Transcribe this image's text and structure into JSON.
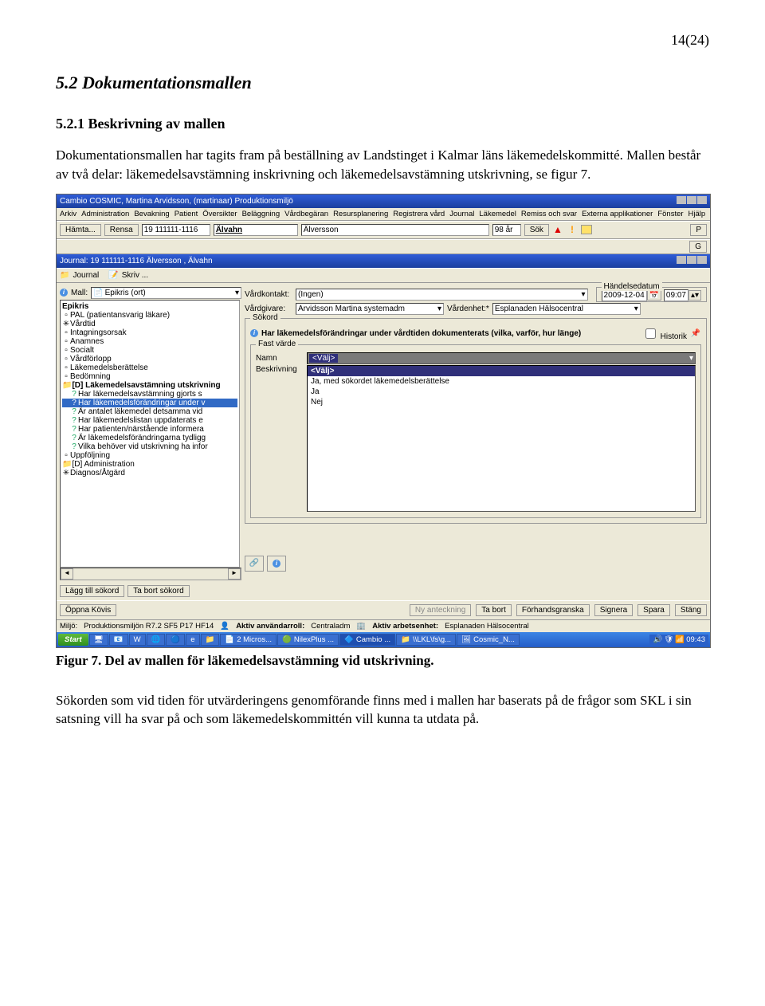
{
  "page_number": "14(24)",
  "h2": "5.2   Dokumentationsmallen",
  "h3": "5.2.1  Beskrivning av mallen",
  "para1": "Dokumentationsmallen har tagits fram på beställning av Landstinget i Kalmar läns läkemedelskommitté. Mallen består av två delar: läkemedelsavstämning inskrivning och läkemedelsavstämning utskrivning, se figur 7.",
  "caption": "Figur 7. Del av mallen för läkemedelsavstämning vid utskrivning.",
  "para2": "Sökorden som vid tiden för utvärderingens genomförande finns med i mallen har baserats på de frågor som SKL i sin satsning vill ha svar på och som läkemedelskommittén vill kunna ta utdata på.",
  "app": {
    "title": "Cambio COSMIC, Martina Arvidsson, (martinaar) Produktionsmiljö",
    "menu": [
      "Arkiv",
      "Administration",
      "Bevakning",
      "Patient",
      "Översikter",
      "Beläggning",
      "Vårdbegäran",
      "Resursplanering",
      "Registrera vård",
      "Journal",
      "Läkemedel",
      "Remiss och svar",
      "Externa applikationer",
      "Fönster",
      "Hjälp"
    ],
    "toolbar": {
      "hamta": "Hämta...",
      "rensa": "Rensa",
      "pnr": "19 111111-1116",
      "fname": "Älvahn",
      "lname": "Älversson",
      "age": "98 år",
      "sok": "Sök",
      "p": "P",
      "g": "G"
    },
    "journal_title": "Journal: 19 111111-1116 Älversson , Älvahn",
    "tabs": {
      "journal": "Journal",
      "skriv": "Skriv ..."
    },
    "mall_label": "Mall:",
    "mall_value": "Epikris (ort)",
    "tree_root": "Epikris",
    "tree_items": [
      "PAL (patientansvarig läkare)",
      "Vårdtid",
      "Intagningsorsak",
      "Anamnes",
      "Socialt",
      "Vårdförlopp",
      "Läkemedelsberättelse",
      "Bedömning"
    ],
    "tree_d": "[D] Läkemedelsavstämning utskrivning",
    "tree_q": [
      "Har läkemedelsavstämning gjorts s",
      "Har läkemedelsförändringar under v",
      "Är antalet läkemedel detsamma vid",
      "Har läkemedelslistan uppdaterats e",
      "Har patienten/närstående informera",
      "Är läkemedelsförändringarna tydligg",
      "Vilka behöver vid utskrivning ha infor"
    ],
    "tree_uppf": "Uppföljning",
    "tree_admin": "[D] Administration",
    "tree_diag": "Diagnos/Åtgärd",
    "tree_btns": {
      "add": "Lägg till sökord",
      "del": "Ta bort sökord"
    },
    "main": {
      "vardkontakt_l": "Vårdkontakt:",
      "vardkontakt_v": "(Ingen)",
      "vardgivare_l": "Vårdgivare:",
      "vardgivare_v": "Arvidsson Martina systemadm",
      "vardenhet_l": "Vårdenhet:*",
      "vardenhet_v": "Esplanaden Hälsocentral",
      "handelse_l": "Händelsedatum",
      "date": "2009-12-04",
      "time": "09:07",
      "sokord_l": "Sökord",
      "info": "Har läkemedelsförändringar under vårdtiden dokumenterats (vilka, varför, hur länge)",
      "historik": "Historik",
      "fast_l": "Fast värde",
      "namn_l": "Namn",
      "namn_v": "<Välj>",
      "beskr_l": "Beskrivning",
      "beskr_head": "<Välj>",
      "opt1": "Ja, med sökordet läkemedelsberättelse",
      "opt2": "Ja",
      "opt3": "Nej"
    },
    "bottom": {
      "oppna": "Öppna Kövis",
      "ny": "Ny anteckning",
      "tabort": "Ta bort",
      "forhands": "Förhandsgranska",
      "signera": "Signera",
      "spara": "Spara",
      "stang": "Stäng"
    },
    "status": {
      "miljo_l": "Miljö:",
      "miljo_v": "Produktionsmiljön R7.2 SF5 P17 HF14",
      "roll_l": "Aktiv användarroll:",
      "roll_v": "Centraladm",
      "enhet_l": "Aktiv arbetsenhet:",
      "enhet_v": "Esplanaden Hälsocentral"
    },
    "taskbar": {
      "start": "Start",
      "items": [
        "2 Micros...",
        "NilexPlus ...",
        "Cambio ...",
        "\\\\LKL\\fs\\g...",
        "Cosmic_N..."
      ],
      "clock": "09:43"
    }
  }
}
